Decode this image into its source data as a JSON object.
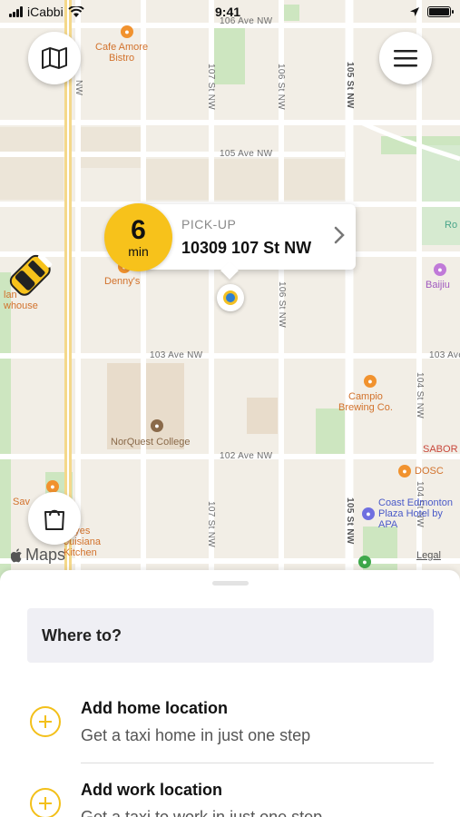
{
  "status_bar": {
    "carrier": "iCabbi",
    "time": "9:41"
  },
  "map": {
    "streets": {
      "h1": "106 Ave NW",
      "h2": "105 Ave NW",
      "h3": "103 Ave NW",
      "h4": "102 Ave NW",
      "h3_right": "103 Ave NW",
      "v1": "107 St NW",
      "v2": "106 St NW",
      "v3": "105 St NW",
      "v4": "106 St NW",
      "v5": "107 St NW",
      "v6": "105 St NW",
      "v7": "104 St NW",
      "v8": "104 St NW",
      "v_left": "NW"
    },
    "pois": {
      "cafe": "Cafe Amore\nBistro",
      "dennys": "Denny's",
      "norquest": "NorQuest College",
      "campio": "Campio\nBrewing Co.",
      "dosc": "DOSC",
      "coast": "Coast Edmonton\nPlaza Hotel by\nAPA",
      "sabor": "SABOR",
      "baijiu": "Baijiu",
      "ro": "Ro",
      "popeyes": "peyes\nouisiana\nKitchen",
      "save_on": "Sav      ods",
      "left_poi": "lan\nwhouse"
    },
    "maps_logo": "Maps",
    "legal": "Legal"
  },
  "pickup": {
    "eta_value": "6",
    "eta_unit": "min",
    "label": "PICK-UP",
    "address": "10309 107 St NW"
  },
  "sheet": {
    "search_placeholder": "Where to?",
    "items": [
      {
        "title": "Add home location",
        "subtitle": "Get a taxi home in just one step"
      },
      {
        "title": "Add work location",
        "subtitle": "Get a taxi to work in just one step"
      }
    ]
  },
  "colors": {
    "accent_yellow": "#f7c21b",
    "pin_blue": "#2f7fd1"
  }
}
